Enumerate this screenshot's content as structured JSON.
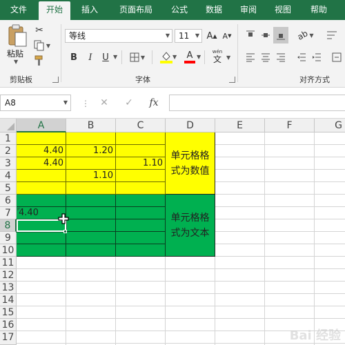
{
  "ribbon_tabs": [
    {
      "label": "文件"
    },
    {
      "label": "开始"
    },
    {
      "label": "插入"
    },
    {
      "label": "页面布局"
    },
    {
      "label": "公式"
    },
    {
      "label": "数据"
    },
    {
      "label": "审阅"
    },
    {
      "label": "视图"
    },
    {
      "label": "帮助"
    }
  ],
  "active_tab": "开始",
  "clipboard": {
    "paste_label": "粘贴",
    "group_label": "剪贴板"
  },
  "font": {
    "name": "等线",
    "size": "11",
    "bold": "B",
    "italic": "I",
    "underline": "U",
    "grow": "A",
    "shrink": "A",
    "fill_color": "#ffff00",
    "font_color": "#ff0000",
    "phonetic": "wén",
    "phonetic_char": "文",
    "group_label": "字体"
  },
  "alignment": {
    "group_label": "对齐方式"
  },
  "formula_bar": {
    "name_box": "A8",
    "cancel": "✕",
    "enter": "✓",
    "fx": "fx",
    "content": ""
  },
  "sheet": {
    "columns": [
      "A",
      "B",
      "C",
      "D",
      "E",
      "F",
      "G"
    ],
    "selected_column": "A",
    "rows": [
      "1",
      "2",
      "3",
      "4",
      "5",
      "6",
      "7",
      "8",
      "9",
      "10",
      "11",
      "12",
      "13",
      "14",
      "15",
      "16",
      "17"
    ],
    "selected_row": "8",
    "cells": {
      "A2": "4.40",
      "B2": "1.20",
      "A3": "4.40",
      "C3": "1.10",
      "B4": "1.10",
      "A7": "4.40"
    },
    "merged_d2_d5": "单元格格式为数值",
    "merged_d6_d10": "单元格格式为文本",
    "yellow_color": "#ffff00",
    "green_color": "#00b050",
    "active_cell": "A8"
  },
  "watermark": "Bai 经验"
}
